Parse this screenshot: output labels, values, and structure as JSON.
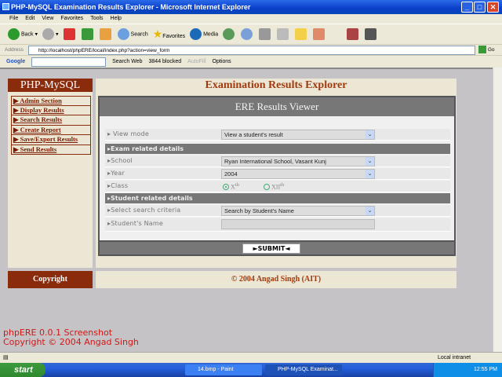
{
  "window": {
    "title": "PHP-MySQL Examination Results Explorer - Microsoft Internet Explorer"
  },
  "menu": [
    "File",
    "Edit",
    "View",
    "Favorites",
    "Tools",
    "Help"
  ],
  "toolbar": {
    "back": "Back",
    "search": "Search",
    "favorites": "Favorites",
    "media": "Media"
  },
  "address": {
    "label": "Address",
    "url": "http://localhost/phpERE/local/index.php?action=view_form",
    "go": "Go"
  },
  "google": {
    "logo": "Google",
    "search_web": "Search Web",
    "blocked": "3844 blocked",
    "autofill": "AutoFill",
    "options": "Options"
  },
  "page": {
    "brand": "PHP-MySQL",
    "header": "Examination Results Explorer",
    "nav": [
      "Admin Section",
      "Display Results",
      "Search Results",
      "Create Report",
      "Save/Export Results",
      "Send Results"
    ],
    "panel_title": "ERE Results Viewer",
    "view_mode": {
      "label": "View mode",
      "value": "View a student's result"
    },
    "exam_section": "Exam related details",
    "school": {
      "label": "School",
      "value": "Ryan International School, Vasant Kunj"
    },
    "year": {
      "label": "Year",
      "value": "2004"
    },
    "class": {
      "label": "Class",
      "opt1": "X",
      "opt1_sup": "th",
      "opt2": "XII",
      "opt2_sup": "th",
      "selected": "X"
    },
    "student_section": "Student related details",
    "criteria": {
      "label": "Select search criteria",
      "value": "Search by Student's Name"
    },
    "name": {
      "label": "Student's Name",
      "value": ""
    },
    "submit": "SUBMIT",
    "footer_left": "Copyright",
    "footer_prefix": "© 2004",
    "footer_author": "Angad Singh",
    "footer_suffix": "(AIT)"
  },
  "caption": {
    "line1": "phpERE 0.0.1 Screenshot",
    "line2": "Copyright © 2004 Angad Singh"
  },
  "status": {
    "zone": "Local intranet"
  },
  "taskbar": {
    "start": "start",
    "tasks": [
      "14.bmp - Paint",
      "PHP-MySQL Examinat..."
    ],
    "clock": "12:55 PM"
  }
}
